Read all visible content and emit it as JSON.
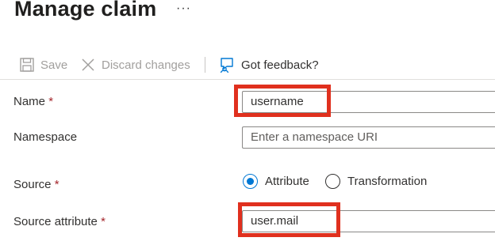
{
  "header": {
    "title": "Manage claim",
    "more_label": "···"
  },
  "toolbar": {
    "save_label": "Save",
    "discard_label": "Discard changes",
    "feedback_label": "Got feedback?"
  },
  "form": {
    "required_mark": "*",
    "name": {
      "label": "Name",
      "value": "username"
    },
    "namespace": {
      "label": "Namespace",
      "placeholder": "Enter a namespace URI"
    },
    "source": {
      "label": "Source",
      "options": [
        "Attribute",
        "Transformation"
      ],
      "selected": "Attribute"
    },
    "source_attribute": {
      "label": "Source attribute",
      "value": "user.mail"
    }
  },
  "colors": {
    "accent": "#0078d4",
    "highlight": "#e0301e",
    "required": "#a4262c"
  }
}
